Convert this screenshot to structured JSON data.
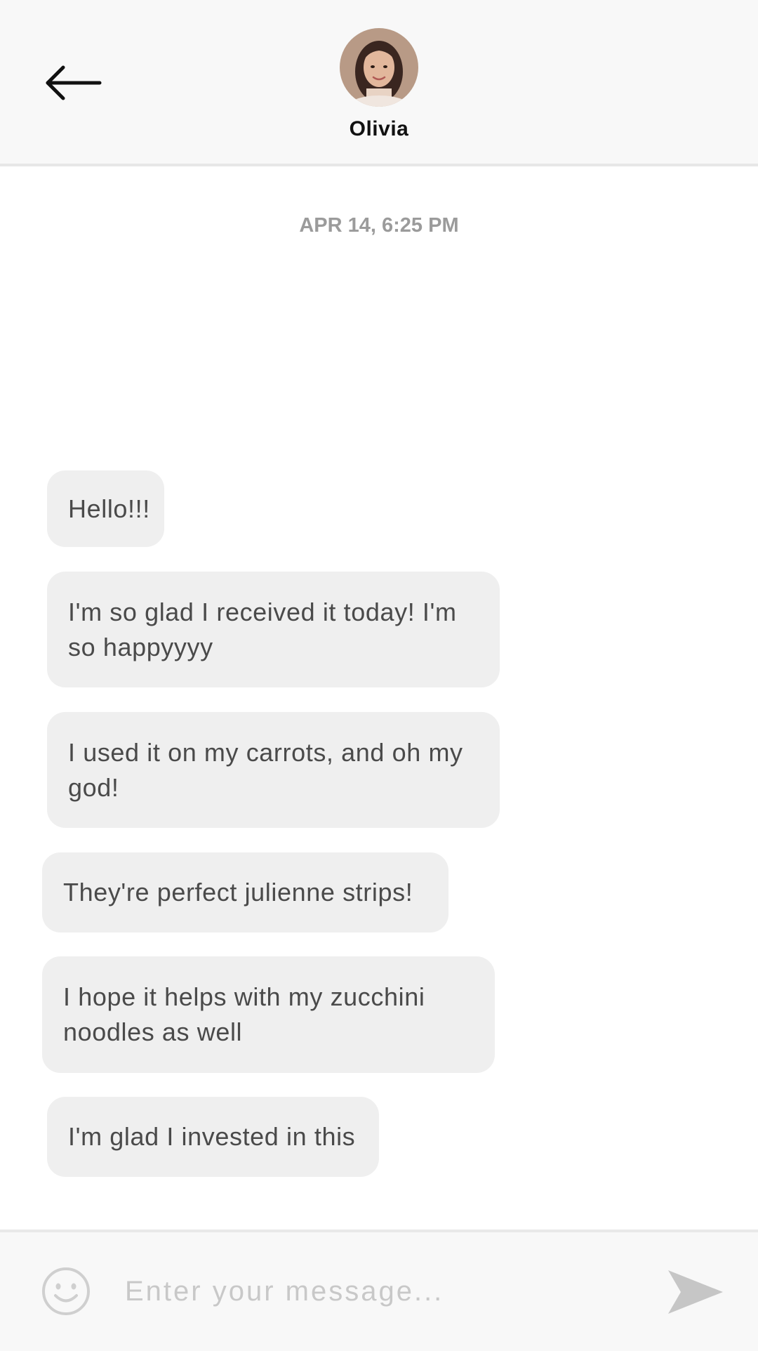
{
  "header": {
    "back_icon": "arrow-left-icon",
    "contact_name": "Olivia"
  },
  "conversation": {
    "timestamp": "APR 14, 6:25 PM",
    "messages": [
      {
        "text": "Hello!!!"
      },
      {
        "text": "I'm so glad I received it today! I'm so happyyyy"
      },
      {
        "text": "I used it on my carrots, and oh my god!"
      },
      {
        "text": "They're perfect julienne strips!"
      },
      {
        "text": "I hope it helps with my zucchini noodles as well"
      },
      {
        "text": "I'm glad I invested in this"
      }
    ]
  },
  "composer": {
    "placeholder": "Enter your message...",
    "emoji_icon": "smiley-face-icon",
    "send_icon": "send-arrow-icon"
  },
  "colors": {
    "header_bg": "#f8f8f8",
    "bubble_bg": "#efefef",
    "bubble_text": "#4a4a4a",
    "timestamp_text": "#9b9b9b",
    "placeholder_text": "#c8c8c8",
    "send_icon": "#c6c6c6"
  }
}
